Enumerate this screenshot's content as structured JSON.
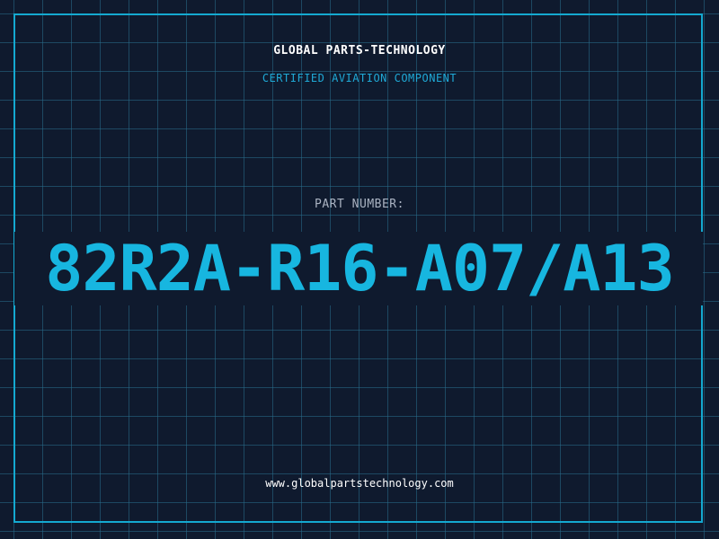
{
  "header": {
    "company_name": "GLOBAL PARTS-TECHNOLOGY",
    "tagline": "CERTIFIED AVIATION COMPONENT"
  },
  "part": {
    "label": "PART NUMBER:",
    "number": "82R2A-R16-A07/A13"
  },
  "footer": {
    "website": "www.globalpartstechnology.com"
  },
  "colors": {
    "background": "#0f1a2e",
    "accent": "#17b6e0",
    "grid": "#286e8c",
    "border": "#14a9d0"
  }
}
